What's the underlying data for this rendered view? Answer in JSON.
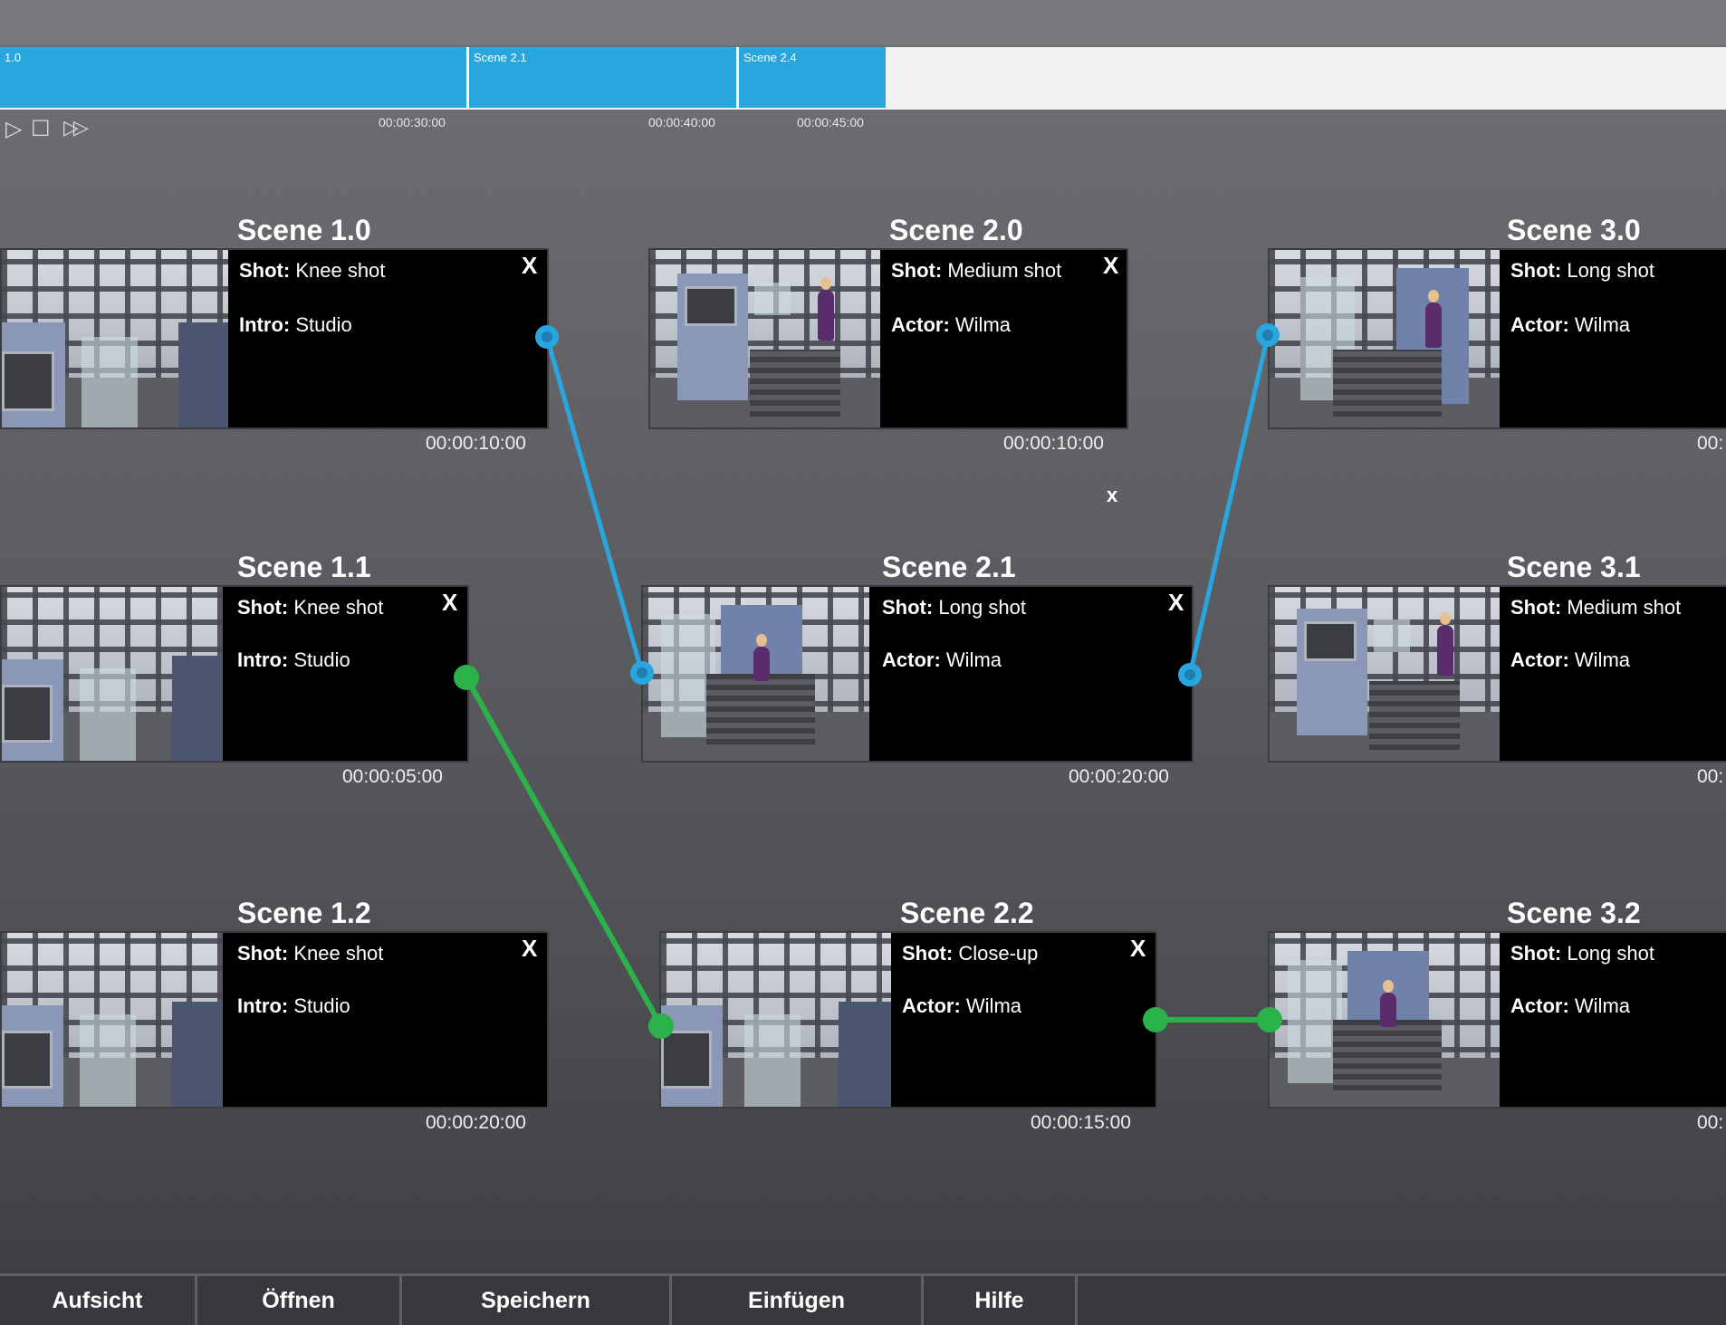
{
  "timeline": {
    "segments": [
      {
        "label": "1.0"
      },
      {
        "label": "Scene 2.1"
      },
      {
        "label": "Scene 2.4"
      }
    ],
    "ticks": [
      "00:00:30:00",
      "00:00:40:00",
      "00:00:45:00"
    ],
    "controls": {
      "play": "▷",
      "stop": "☐",
      "forward": "▷▷"
    }
  },
  "scenes": [
    {
      "title": "Scene 1.0",
      "shot_label": "Shot:",
      "shot": "Knee shot",
      "detail_label": "Intro:",
      "detail": "Studio",
      "close": "X",
      "duration": "00:00:10:00"
    },
    {
      "title": "Scene 2.0",
      "shot_label": "Shot:",
      "shot": "Medium shot",
      "detail_label": "Actor:",
      "detail": "Wilma",
      "close": "X",
      "duration": "00:00:10:00"
    },
    {
      "title": "Scene 3.0",
      "shot_label": "Shot:",
      "shot": "Long shot",
      "detail_label": "Actor:",
      "detail": "Wilma",
      "close": "",
      "duration": "00:"
    },
    {
      "title": "Scene 1.1",
      "shot_label": "Shot:",
      "shot": "Knee shot",
      "detail_label": "Intro:",
      "detail": "Studio",
      "close": "X",
      "duration": "00:00:05:00"
    },
    {
      "title": "Scene 2.1",
      "shot_label": "Shot:",
      "shot": "Long shot",
      "detail_label": "Actor:",
      "detail": "Wilma",
      "close": "X",
      "duration": "00:00:20:00"
    },
    {
      "title": "Scene 3.1",
      "shot_label": "Shot:",
      "shot": "Medium shot",
      "detail_label": "Actor:",
      "detail": "Wilma",
      "close": "",
      "duration": "00:"
    },
    {
      "title": "Scene 1.2",
      "shot_label": "Shot:",
      "shot": "Knee shot",
      "detail_label": "Intro:",
      "detail": "Studio",
      "close": "X",
      "duration": "00:00:20:00"
    },
    {
      "title": "Scene 2.2",
      "shot_label": "Shot:",
      "shot": "Close-up",
      "detail_label": "Actor:",
      "detail": "Wilma",
      "close": "X",
      "duration": "00:00:15:00"
    },
    {
      "title": "Scene 3.2",
      "shot_label": "Shot:",
      "shot": "Long shot",
      "detail_label": "Actor:",
      "detail": "Wilma",
      "close": "",
      "duration": "00:"
    }
  ],
  "floating_close": "x",
  "connections": [
    {
      "from": "Scene 1.0",
      "to": "Scene 2.1",
      "color": "#29a6de"
    },
    {
      "from": "Scene 2.1",
      "to": "Scene 3.0",
      "color": "#29a6de"
    },
    {
      "from": "Scene 1.1",
      "to": "Scene 2.2",
      "color": "#2bb24a"
    },
    {
      "from": "Scene 2.2",
      "to": "Scene 3.2",
      "color": "#2bb24a"
    }
  ],
  "toolbar": {
    "items": [
      "Aufsicht",
      "Öffnen",
      "Speichern",
      "Einfügen",
      "Hilfe"
    ]
  },
  "colors": {
    "accent_blue": "#29a6de",
    "accent_green": "#2bb24a",
    "card_bg": "#000000"
  }
}
